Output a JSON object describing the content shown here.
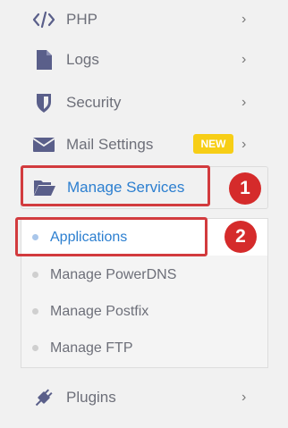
{
  "sidebar": {
    "items": [
      {
        "label": "PHP",
        "icon": "code-icon"
      },
      {
        "label": "Logs",
        "icon": "file-icon"
      },
      {
        "label": "Security",
        "icon": "shield-icon"
      },
      {
        "label": "Mail Settings",
        "icon": "envelope-icon",
        "badge": "NEW"
      },
      {
        "label": "Manage Services",
        "icon": "folder-open-icon"
      },
      {
        "label": "Plugins",
        "icon": "plug-icon"
      }
    ],
    "submenu": [
      {
        "label": "Applications",
        "active": true
      },
      {
        "label": "Manage PowerDNS"
      },
      {
        "label": "Manage Postfix"
      },
      {
        "label": "Manage FTP"
      }
    ]
  },
  "annotations": {
    "step1": "1",
    "step2": "2"
  },
  "colors": {
    "accent": "#2c7fd0",
    "highlight": "#d23b3e",
    "badge": "#f7ce16",
    "icon": "#5a5f8a"
  }
}
